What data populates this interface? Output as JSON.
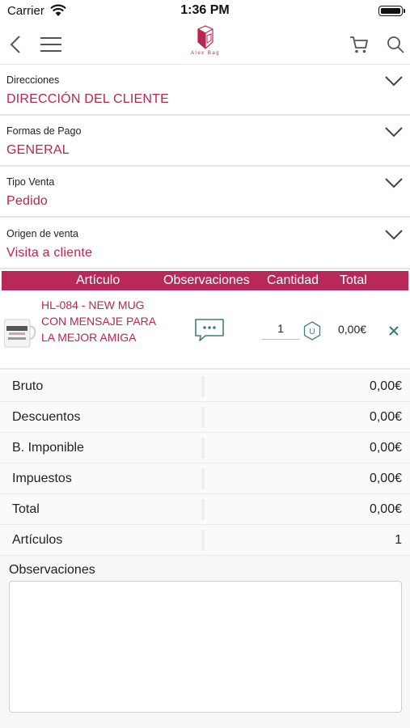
{
  "status_bar": {
    "carrier": "Carrier",
    "time": "1:36 PM"
  },
  "header": {
    "logo_text": "Alex Bag"
  },
  "selectors": [
    {
      "label": "Direcciones",
      "value": "DIRECCIÓN DEL CLIENTE"
    },
    {
      "label": "Formas de Pago",
      "value": "GENERAL"
    },
    {
      "label": "Tipo Venta",
      "value": "Pedido"
    },
    {
      "label": "Origen de venta",
      "value": "Visita a cliente"
    }
  ],
  "table": {
    "headers": {
      "articulo": "Artículo",
      "observaciones": "Observaciones",
      "cantidad": "Cantidad",
      "total": "Total"
    },
    "items": [
      {
        "name": "HL-084 - NEW MUG CON MENSAJE PARA LA MEJOR AMIGA",
        "quantity": "1",
        "unit": "U",
        "total": "0,00€"
      }
    ]
  },
  "totals": [
    {
      "label": "Bruto",
      "value": "0,00€"
    },
    {
      "label": "Descuentos",
      "value": "0,00€"
    },
    {
      "label": "B. Imponible",
      "value": "0,00€"
    },
    {
      "label": "Impuestos",
      "value": "0,00€"
    },
    {
      "label": "Total",
      "value": "0,00€"
    },
    {
      "label": "Artículos",
      "value": "1"
    }
  ],
  "observaciones": {
    "title": "Observaciones",
    "value": ""
  },
  "colors": {
    "accent": "#b8274f",
    "header_bar": "#b8295a",
    "icon_teal": "#3f7f7a"
  }
}
